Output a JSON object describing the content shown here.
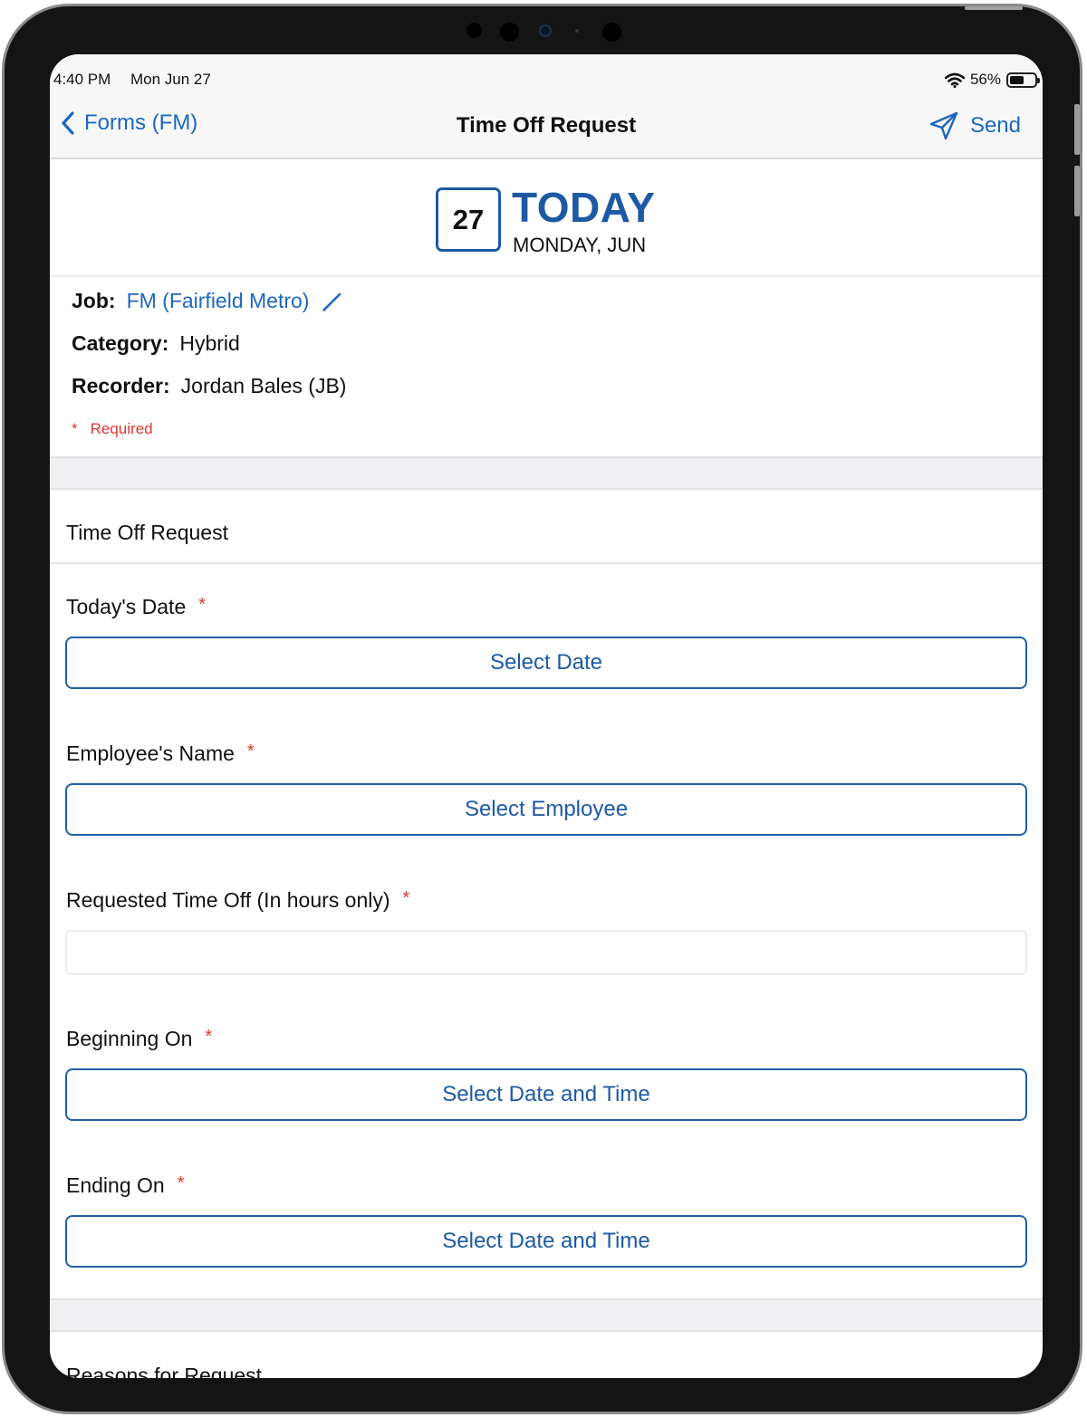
{
  "status_bar": {
    "time": "4:40 PM",
    "date": "Mon Jun 27",
    "battery": "56%",
    "battery_level": 0.56
  },
  "nav": {
    "back_label": "Forms (FM)",
    "title": "Time Off Request",
    "send_label": "Send"
  },
  "date_header": {
    "day_number": "27",
    "heading": "TODAY",
    "subheading": "MONDAY, JUN"
  },
  "info": {
    "job_label": "Job:",
    "job_value": "FM (Fairfield Metro)",
    "category_label": "Category:",
    "category_value": "Hybrid",
    "recorder_label": "Recorder:",
    "recorder_value": "Jordan Bales (JB)",
    "required_star": "*",
    "required_text": "Required"
  },
  "form": {
    "section_title": "Time Off Request",
    "fields": [
      {
        "label": "Today's Date",
        "star": "*",
        "button": "Select Date"
      },
      {
        "label": "Employee's Name",
        "star": "*",
        "button": "Select Employee"
      },
      {
        "label": "Requested Time Off (In hours only)",
        "star": "*",
        "value": "",
        "placeholder": ""
      },
      {
        "label": "Beginning On",
        "star": "*",
        "button": "Select Date and Time"
      },
      {
        "label": "Ending On",
        "star": "*",
        "button": "Select Date and Time"
      }
    ],
    "next_section_title": "Reasons for Request"
  },
  "colors": {
    "accent": "#1d67bf",
    "brand_dark_blue": "#1d5aa6",
    "required_red": "#e0372e"
  },
  "icons": {
    "back": "chevron-left-icon",
    "send": "paper-plane-icon",
    "edit": "pencil-icon",
    "wifi": "wifi-icon",
    "battery": "battery-icon"
  }
}
